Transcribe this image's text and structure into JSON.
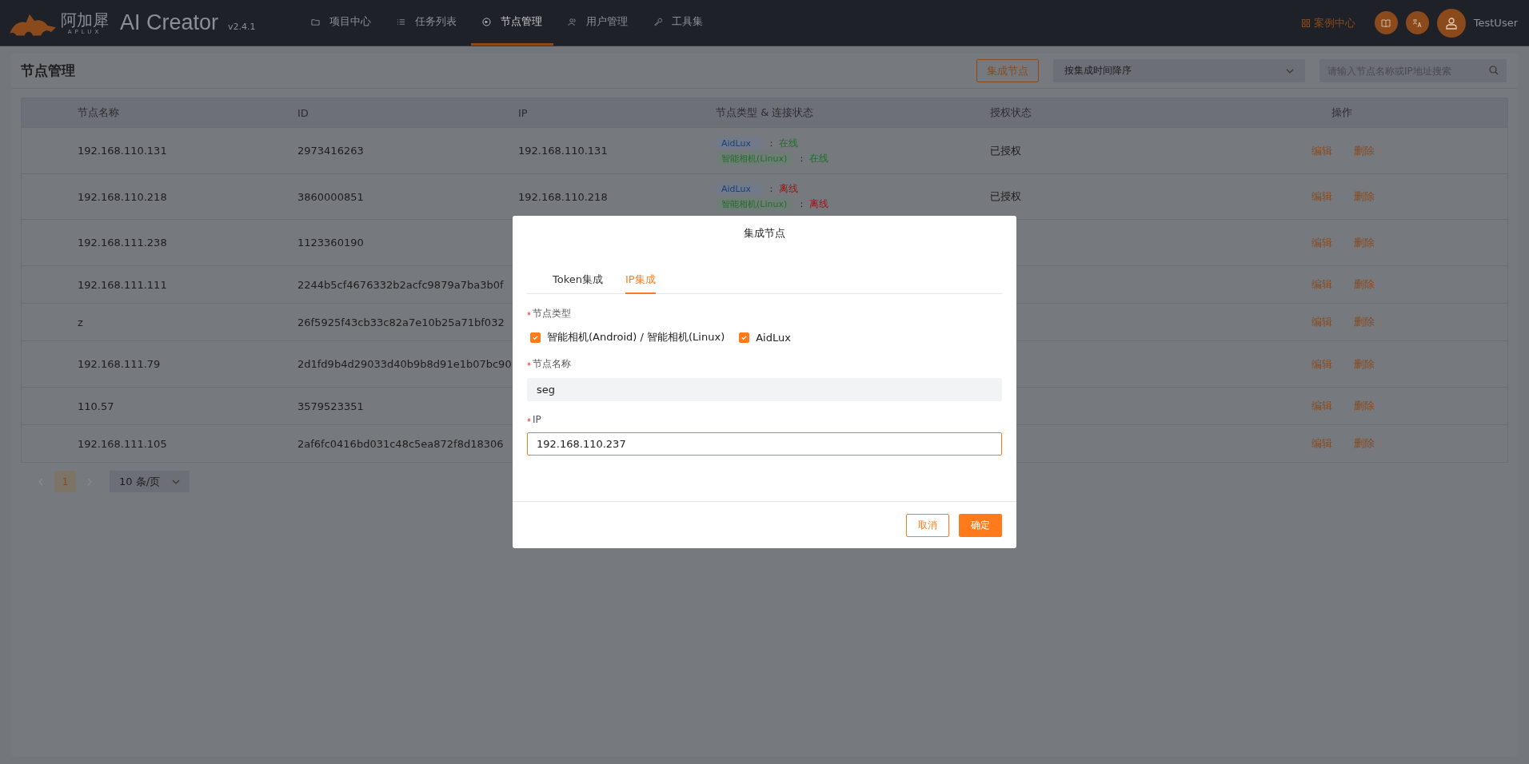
{
  "header": {
    "brand": "阿加犀",
    "brand_sub": "APLUX",
    "app_name": "AI Creator",
    "version": "v2.4.1",
    "nav": [
      {
        "label": "项目中心",
        "selected": false
      },
      {
        "label": "任务列表",
        "selected": false
      },
      {
        "label": "节点管理",
        "selected": true
      },
      {
        "label": "用户管理",
        "selected": false
      },
      {
        "label": "工具集",
        "selected": false
      }
    ],
    "case_center": "案例中心",
    "user": "TestUser"
  },
  "page": {
    "title": "节点管理",
    "add_button": "集成节点",
    "sort_select": "按集成时间降序",
    "search": {
      "placeholder": "请输入节点名称或IP地址搜索"
    }
  },
  "table": {
    "columns": [
      "节点名称",
      "ID",
      "IP",
      "节点类型 & 连接状态",
      "授权状态",
      "操作"
    ],
    "rows": [
      {
        "name": "192.168.110.131",
        "id": "2973416263",
        "ip": "192.168.110.131",
        "types": [
          {
            "kind": "aidlux",
            "label": "AidLux",
            "sep": "：",
            "status": "在线",
            "online": true
          },
          {
            "kind": "camera",
            "label": "智能相机(Linux)",
            "sep": "：",
            "status": "在线",
            "online": true
          }
        ],
        "auth": "已授权",
        "actions": [
          "编辑",
          "删除"
        ]
      },
      {
        "name": "192.168.110.218",
        "id": "3860000851",
        "ip": "192.168.110.218",
        "types": [
          {
            "kind": "aidlux",
            "label": "AidLux",
            "sep": "：",
            "status": "离线",
            "online": false
          },
          {
            "kind": "camera",
            "label": "智能相机(Linux)",
            "sep": "：",
            "status": "离线",
            "online": false
          }
        ],
        "auth": "已授权",
        "actions": [
          "编辑",
          "删除"
        ]
      },
      {
        "name": "192.168.111.238",
        "id": "1123360190",
        "actions": [
          "编辑",
          "删除"
        ]
      },
      {
        "name": "192.168.111.111",
        "id": "2244b5cf4676332b2acfc9879a7ba3b0f",
        "actions": [
          "编辑",
          "删除"
        ]
      },
      {
        "name": "z",
        "id": "26f5925f43cb33c82a7e10b25a71bf032",
        "actions": [
          "编辑",
          "删除"
        ]
      },
      {
        "name": "192.168.111.79",
        "id": "2d1fd9b4d29033d40b9b8d91e1b07bc90",
        "actions": [
          "编辑",
          "删除"
        ]
      },
      {
        "name": "110.57",
        "id": "3579523351",
        "actions": [
          "编辑",
          "删除"
        ]
      },
      {
        "name": "192.168.111.105",
        "id": "2af6fc0416bd031c48c5ea872f8d18306",
        "actions": [
          "编辑",
          "删除"
        ]
      }
    ]
  },
  "pagination": {
    "pages": [
      {
        "label": "1",
        "selected": true
      }
    ],
    "page_size": "10 条/页"
  },
  "dialog": {
    "title": "集成节点",
    "tabs": [
      {
        "label": "Token集成",
        "selected": false
      },
      {
        "label": "IP集成",
        "selected": true
      }
    ],
    "node_type": {
      "label": "节点类型",
      "required": true,
      "options": [
        {
          "label": "智能相机(Android) / 智能相机(Linux)",
          "checked": true
        },
        {
          "label": "AidLux",
          "checked": true
        }
      ]
    },
    "node_name": {
      "label": "节点名称",
      "required": true,
      "value": "seg",
      "focused": false
    },
    "ip": {
      "label": "IP",
      "required": true,
      "value": "192.168.110.237",
      "focused": true
    },
    "cancel": "取消",
    "ok": "确定"
  }
}
